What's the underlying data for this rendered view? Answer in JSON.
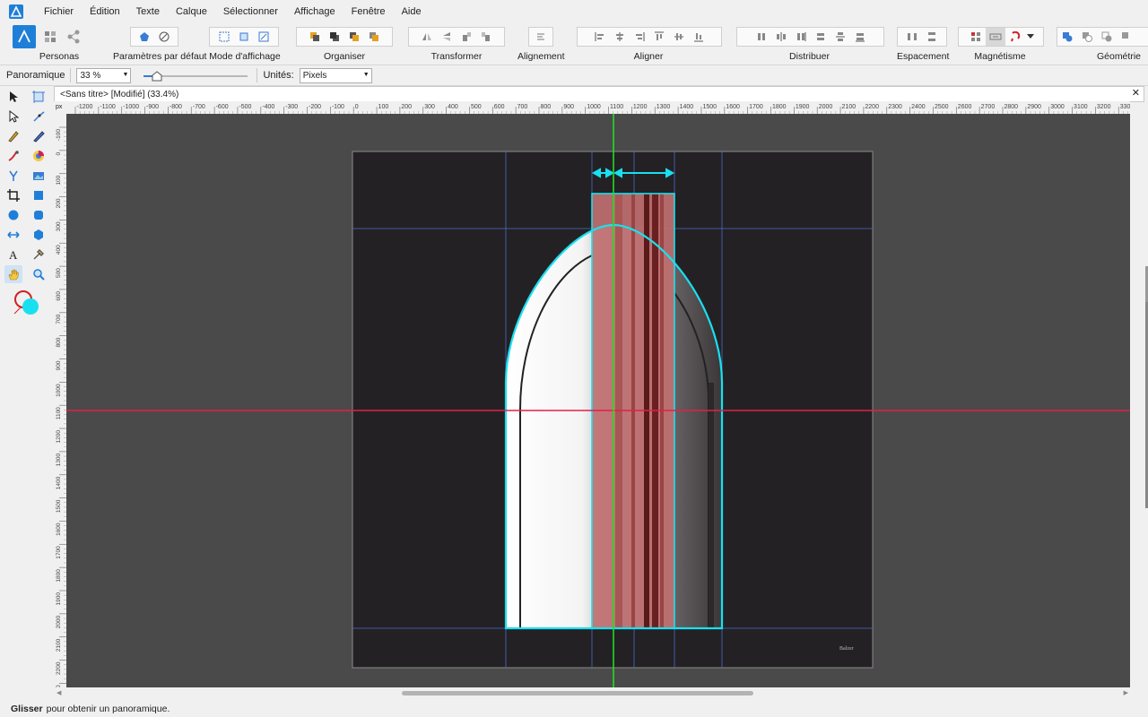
{
  "menu": [
    "Fichier",
    "Édition",
    "Texte",
    "Calque",
    "Sélectionner",
    "Affichage",
    "Fenêtre",
    "Aide"
  ],
  "toolbar": {
    "personas": "Personas",
    "defaults": "Paramètres par défaut",
    "view_mode": "Mode d'affichage",
    "arrange": "Organiser",
    "transform": "Transformer",
    "alignment": "Alignement",
    "align": "Aligner",
    "distribute": "Distribuer",
    "spacing": "Espacement",
    "snapping": "Magnétisme",
    "geometry": "Géométrie"
  },
  "context": {
    "tool_name": "Panoramique",
    "zoom_value": "33 %",
    "units_label": "Unités:",
    "units_value": "Pixels"
  },
  "document": {
    "tab_title": "<Sans titre> [Modifié] (33.4%)",
    "signature": "Balzer"
  },
  "ruler": {
    "unit": "px",
    "h_labels": [
      "-1200",
      "-1100",
      "-1000",
      "-900",
      "-800",
      "-700",
      "-600",
      "-500",
      "-400",
      "-300",
      "-200",
      "-100",
      "0",
      "100",
      "200",
      "300",
      "400",
      "500",
      "600",
      "700",
      "800",
      "900",
      "1000",
      "1100",
      "1200",
      "1300",
      "1400",
      "1500",
      "1600",
      "1700",
      "1800",
      "1900",
      "2000",
      "2100",
      "2200",
      "2300",
      "2400",
      "2500",
      "2600",
      "2700",
      "2800",
      "2900",
      "3000",
      "3100",
      "3200",
      "3300"
    ],
    "v_labels": [
      "-100",
      "0",
      "100",
      "200",
      "300",
      "400",
      "500",
      "600",
      "700",
      "800",
      "900",
      "1000",
      "1100",
      "1200",
      "1300",
      "1400",
      "1500",
      "1600",
      "1700",
      "1800",
      "1900",
      "2000",
      "2100",
      "2200",
      "2300"
    ]
  },
  "status": {
    "bold": "Glisser",
    "text": "pour obtenir un panoramique."
  },
  "colors": {
    "selection": "#19e0f0",
    "h_guide": "#e0204a",
    "v_guide": "#22dd22",
    "blue_guide": "#4a6cc8",
    "artboard": "#242124",
    "canvas_bg": "#4a4a4a"
  }
}
